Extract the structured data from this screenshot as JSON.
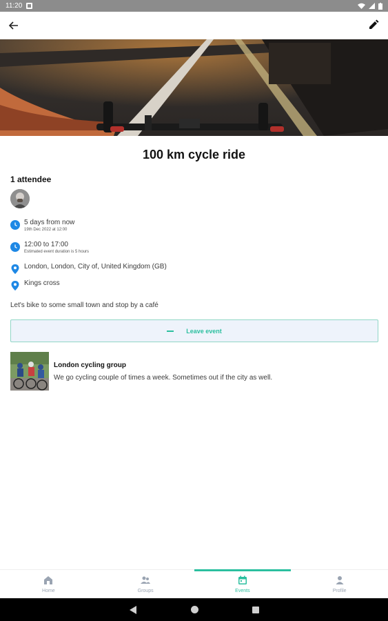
{
  "status_bar": {
    "time": "11:20"
  },
  "event": {
    "title": "100 km cycle ride",
    "attendees_label": "1 attendee",
    "when": {
      "relative": "5 days from now",
      "date": "19th Dec 2022 at 12:00"
    },
    "time": {
      "range": "12:00 to 17:00",
      "duration": "Estimated event duration is 5 hours"
    },
    "location": "London, London, City of, United Kingdom (GB)",
    "place": "Kings cross",
    "description": "Let's bike to some small town and stop by a café",
    "leave_label": "Leave event"
  },
  "group": {
    "name": "London cycling group",
    "description": "We go cycling couple of times a week. Sometimes out if the city as well."
  },
  "nav": {
    "items": [
      {
        "label": "Home",
        "icon": "home-icon"
      },
      {
        "label": "Groups",
        "icon": "groups-icon"
      },
      {
        "label": "Events",
        "icon": "calendar-icon",
        "active": true
      },
      {
        "label": "Profile",
        "icon": "person-icon"
      }
    ]
  },
  "colors": {
    "accent": "#2bbf9f",
    "info_icon": "#1e88e5",
    "nav_inactive": "#9aa4b2"
  }
}
